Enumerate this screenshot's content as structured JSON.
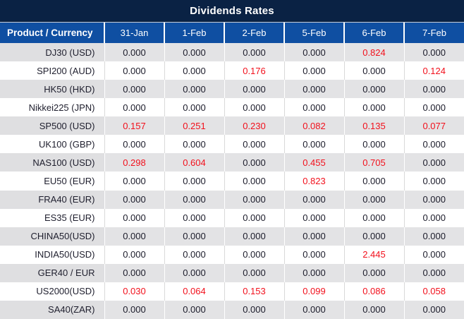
{
  "title": "Dividends Rates",
  "colors": {
    "title_bar_bg": "#0a2244",
    "header_bg": "#0f4fa2",
    "alt_row_bg": "#e3e3e5",
    "value_text": "#1b1b2a",
    "nonzero_value_text": "#f2101c"
  },
  "table": {
    "product_header": "Product / Currency",
    "date_headers": [
      "31-Jan",
      "1-Feb",
      "2-Feb",
      "5-Feb",
      "6-Feb",
      "7-Feb"
    ],
    "rows": [
      {
        "product": "DJ30 (USD)",
        "values": [
          "0.000",
          "0.000",
          "0.000",
          "0.000",
          "0.824",
          "0.000"
        ]
      },
      {
        "product": "SPI200 (AUD)",
        "values": [
          "0.000",
          "0.000",
          "0.176",
          "0.000",
          "0.000",
          "0.124"
        ]
      },
      {
        "product": "HK50 (HKD)",
        "values": [
          "0.000",
          "0.000",
          "0.000",
          "0.000",
          "0.000",
          "0.000"
        ]
      },
      {
        "product": "Nikkei225 (JPN)",
        "values": [
          "0.000",
          "0.000",
          "0.000",
          "0.000",
          "0.000",
          "0.000"
        ]
      },
      {
        "product": "SP500 (USD)",
        "values": [
          "0.157",
          "0.251",
          "0.230",
          "0.082",
          "0.135",
          "0.077"
        ]
      },
      {
        "product": "UK100 (GBP)",
        "values": [
          "0.000",
          "0.000",
          "0.000",
          "0.000",
          "0.000",
          "0.000"
        ]
      },
      {
        "product": "NAS100 (USD)",
        "values": [
          "0.298",
          "0.604",
          "0.000",
          "0.455",
          "0.705",
          "0.000"
        ]
      },
      {
        "product": "EU50 (EUR)",
        "values": [
          "0.000",
          "0.000",
          "0.000",
          "0.823",
          "0.000",
          "0.000"
        ]
      },
      {
        "product": "FRA40 (EUR)",
        "values": [
          "0.000",
          "0.000",
          "0.000",
          "0.000",
          "0.000",
          "0.000"
        ]
      },
      {
        "product": "ES35 (EUR)",
        "values": [
          "0.000",
          "0.000",
          "0.000",
          "0.000",
          "0.000",
          "0.000"
        ]
      },
      {
        "product": "CHINA50(USD)",
        "values": [
          "0.000",
          "0.000",
          "0.000",
          "0.000",
          "0.000",
          "0.000"
        ]
      },
      {
        "product": "INDIA50(USD)",
        "values": [
          "0.000",
          "0.000",
          "0.000",
          "0.000",
          "2.445",
          "0.000"
        ]
      },
      {
        "product": "GER40 / EUR",
        "values": [
          "0.000",
          "0.000",
          "0.000",
          "0.000",
          "0.000",
          "0.000"
        ]
      },
      {
        "product": "US2000(USD)",
        "values": [
          "0.030",
          "0.064",
          "0.153",
          "0.099",
          "0.086",
          "0.058"
        ]
      },
      {
        "product": "SA40(ZAR)",
        "values": [
          "0.000",
          "0.000",
          "0.000",
          "0.000",
          "0.000",
          "0.000"
        ]
      }
    ]
  }
}
